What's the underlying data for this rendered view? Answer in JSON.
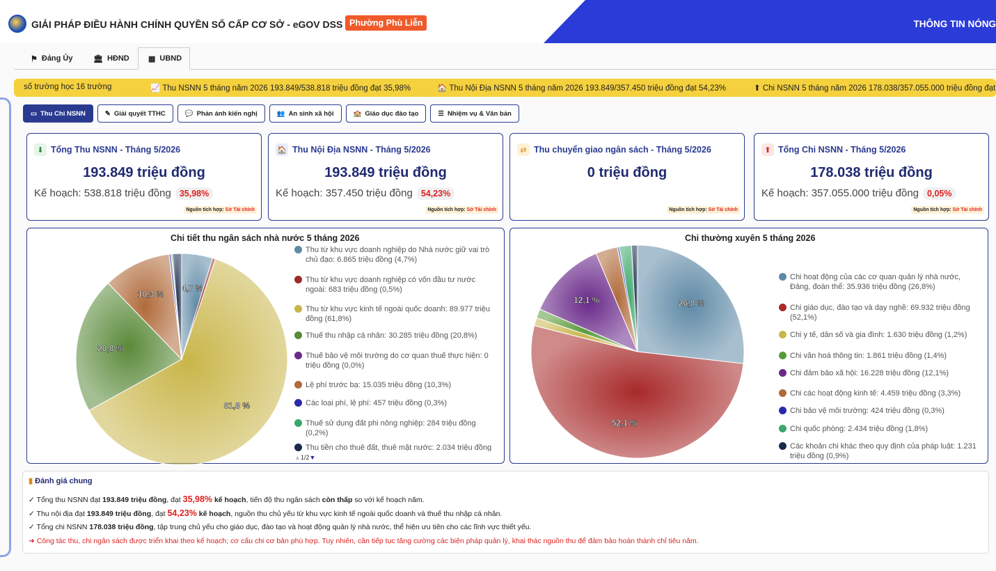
{
  "header": {
    "title": "GIẢI PHÁP ĐIỀU HÀNH CHÍNH QUYỀN SỐ CẤP CƠ SỞ - eGOV DSS",
    "ward": "Phường Phù Liễn",
    "hot": "THÔNG TIN NÓNG"
  },
  "tabs": [
    {
      "label": "Đảng Ủy",
      "icon": "flag-icon"
    },
    {
      "label": "HĐND",
      "icon": "building-columns-icon"
    },
    {
      "label": "UBND",
      "icon": "building-icon"
    }
  ],
  "ticker": [
    "số trường học 16 trường",
    "Thu NSNN 5 tháng năm 2026 193.849/538.818 triệu đồng đạt 35,98%",
    "Thu Nội Địa NSNN 5 tháng năm 2026 193.849/357.450 triệu đồng đạt 54,23%",
    "Chi NSNN 5 tháng năm 2026 178.038/357.055.000 triệu đồng đạt"
  ],
  "subtabs": [
    "Thu Chi NSNN",
    "Giải quyết TTHC",
    "Phản ánh kiến nghị",
    "An sinh xã hội",
    "Giáo dục đào tạo",
    "Nhiệm vụ & Văn bản"
  ],
  "cards": [
    {
      "title": "Tổng Thu NSNN - Tháng 5/2026",
      "value": "193.849 triệu đồng",
      "plan": "Kế hoạch: 538.818 triệu đồng",
      "pct": "35,98%",
      "src_label": "Nguồn tích hợp:",
      "src": "Sở Tài chính"
    },
    {
      "title": "Thu Nội Địa NSNN - Tháng 5/2026",
      "value": "193.849 triệu đồng",
      "plan": "Kế hoạch: 357.450 triệu đồng",
      "pct": "54,23%",
      "src_label": "Nguồn tích hợp:",
      "src": "Sở Tài chính"
    },
    {
      "title": "Thu chuyển giao ngân sách - Tháng 5/2026",
      "value": "0 triệu đồng",
      "plan": "",
      "pct": "",
      "src_label": "Nguồn tích hợp:",
      "src": "Sở Tài chính"
    },
    {
      "title": "Tổng Chi NSNN - Tháng 5/2026",
      "value": "178.038 triệu đồng",
      "plan": "Kế hoạch: 357.055.000 triệu đồng",
      "pct": "0,05%",
      "src_label": "Nguồn tích hợp:",
      "src": "Sở Tài chính"
    }
  ],
  "chart_data": [
    {
      "type": "pie",
      "title": "Chi tiết thu ngân sách nhà nước 5 tháng 2026",
      "categories": [
        "Thu từ khu vực doanh nghiệp do Nhà nước giữ vai trò chủ đạo: 6.865 triệu đồng (4,7%)",
        "Thu từ khu vực doanh nghiệp có vốn đầu tư nước ngoài: 683 triệu đồng (0,5%)",
        "Thu từ khu vực kinh tế ngoài quốc doanh: 89.977 triệu đồng (61,8%)",
        "Thuế thu nhập cá nhân: 30.285 triệu đồng (20,8%)",
        "Thuế bảo vệ môi trường do cơ quan thuế thực hiện: 0 triệu đồng (0,0%)",
        "Lệ phí trước bạ: 15.035 triệu đồng (10,3%)",
        "Các loại phí, lệ phí: 457 triệu đồng (0,3%)",
        "Thuế sử dụng đất phi nông nghiệp: 284 triệu đồng (0,2%)",
        "Thu tiền cho thuê đất, thuê mặt nước: 2.034 triệu đồng"
      ],
      "values": [
        6865,
        683,
        89977,
        30285,
        0,
        15035,
        457,
        284,
        2034
      ],
      "colors": [
        "#5f8aa6",
        "#9b2b2b",
        "#c9b64a",
        "#5a8a3a",
        "#6a2a8a",
        "#b06a3a",
        "#2a2aaa",
        "#3aa86a",
        "#1a2a4a"
      ],
      "slice_labels": [
        "4,7 %",
        "",
        "61,8 %",
        "20,8 %",
        "",
        "10,3 %",
        "",
        "",
        ""
      ],
      "legend_page": "1/2"
    },
    {
      "type": "pie",
      "title": "Chi thường xuyên 5 tháng 2026",
      "categories": [
        "Chi hoạt động của các cơ quan quản lý nhà nước, Đảng, đoàn thể: 35.936 triệu đồng (26,8%)",
        "Chi giáo dục, đào tạo và dạy nghề: 69.932 triệu đồng (52,1%)",
        "Chi y tế, dân số và gia đình: 1.630 triệu đồng (1,2%)",
        "Chi văn hoá thông tin: 1.861 triệu đồng (1,4%)",
        "Chi đảm bảo xã hội: 16.228 triệu đồng (12,1%)",
        "Chi các hoạt động kinh tế: 4.459 triệu đồng (3,3%)",
        "Chi bảo vệ môi trường: 424 triệu đồng (0,3%)",
        "Chi quốc phòng: 2.434 triệu đồng (1,8%)",
        "Các khoản chi khác theo quy định của pháp luật: 1.231 triệu đồng (0,9%)"
      ],
      "values": [
        35936,
        69932,
        1630,
        1861,
        16228,
        4459,
        424,
        2434,
        1231
      ],
      "colors": [
        "#5f8aa6",
        "#a82a2a",
        "#c9b64a",
        "#5a9a3a",
        "#6a2a8a",
        "#b06a3a",
        "#2a2aaa",
        "#3aa86a",
        "#1a2a4a"
      ],
      "slice_labels": [
        "26,8 %",
        "52,1 %",
        "",
        "",
        "12,1 %",
        "",
        "",
        "",
        ""
      ]
    }
  ],
  "eval": {
    "title": "Đánh giá chung",
    "l1": {
      "a": "✓ Tổng thu NSNN đạt ",
      "b": "193.849 triệu đồng",
      "c": ", đạt ",
      "d": "35,98%",
      "e": " kế hoạch",
      "f": ", tiến độ thu ngân sách ",
      "g": "còn thấp",
      "h": " so với kế hoạch năm."
    },
    "l2": {
      "a": "✓ Thu nội địa đạt ",
      "b": "193.849 triệu đồng",
      "c": ", đạt ",
      "d": "54,23%",
      "e": " kế hoạch",
      "f": ", nguồn thu chủ yếu từ khu vực kinh tế ngoài quốc doanh và thuế thu nhập cá nhân."
    },
    "l3": {
      "a": "✓ Tổng chi NSNN ",
      "b": "178.038 triệu đồng",
      "c": ", tập trung chủ yếu cho giáo dục, đào tạo và hoạt động quản lý nhà nước, thể hiện ưu tiên cho các lĩnh vực thiết yếu."
    },
    "l4": "➜ Công tác thu, chi ngân sách được triển khai theo kế hoạch; cơ cấu chi cơ bản phù hợp. Tuy nhiên, cần tiếp tục tăng cường các biện pháp quản lý, khai thác nguồn thu để đảm bảo hoàn thành chỉ tiêu năm."
  }
}
